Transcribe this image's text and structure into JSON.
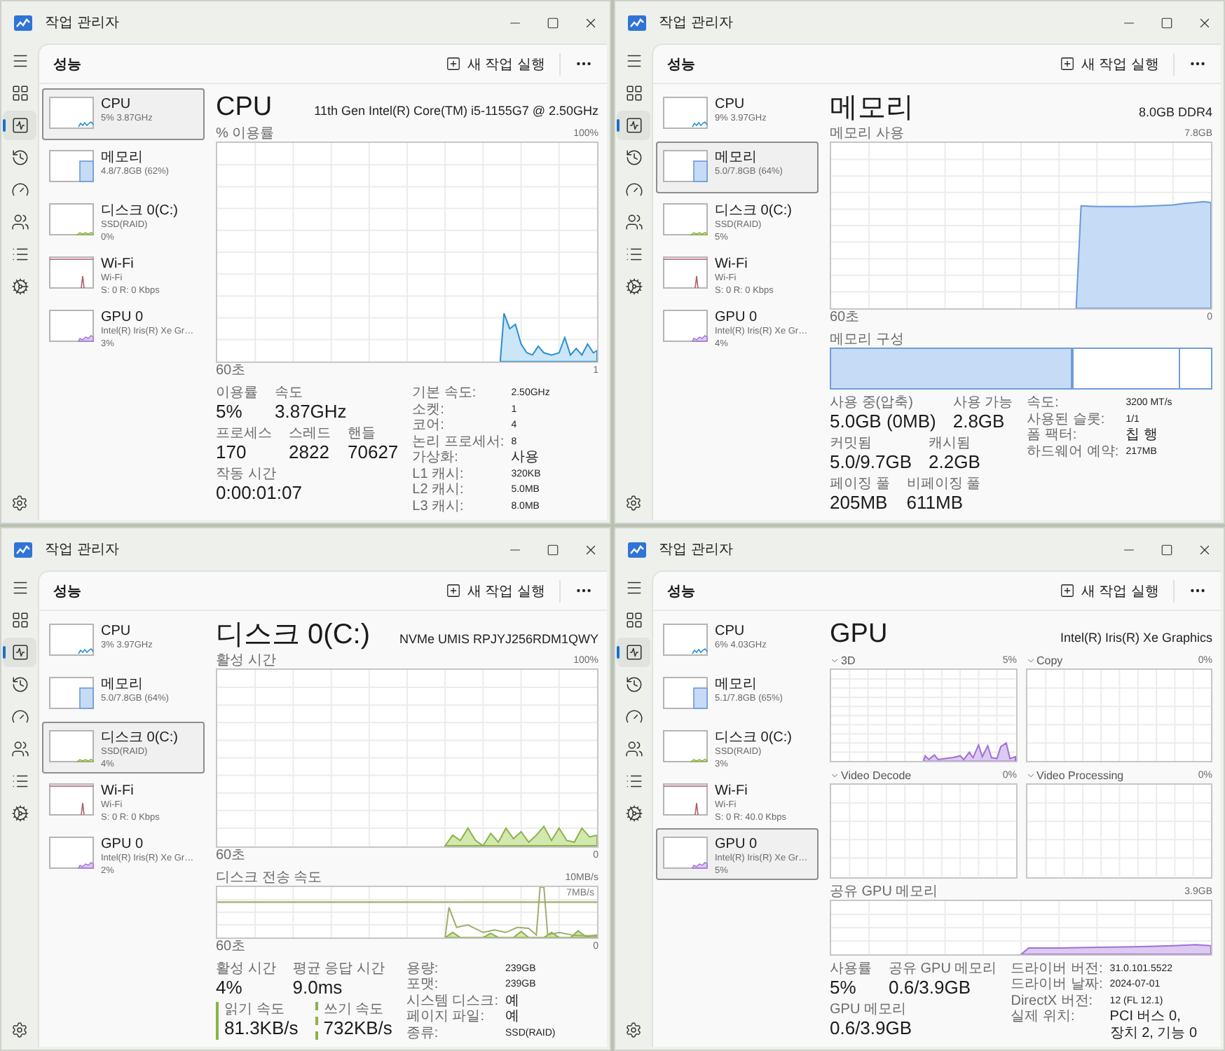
{
  "windows": [
    {
      "kind": "cpu",
      "title": "작업 관리자",
      "nav": [
        {
          "selected": false
        },
        {
          "selected": true
        },
        {
          "selected": false
        },
        {
          "selected": false
        },
        {
          "selected": false
        },
        {
          "selected": false
        },
        {
          "selected": false
        }
      ],
      "page_title": "성능",
      "run_task": "새 작업 실행",
      "devices": [
        {
          "kind": "cpu",
          "name": "CPU",
          "details": [
            "5% 3.87GHz"
          ],
          "selected": true
        },
        {
          "kind": "memory",
          "name": "메모리",
          "details": [
            "4.8/7.8GB (62%)"
          ],
          "selected": false
        },
        {
          "kind": "disk",
          "name": "디스크 0(C:)",
          "details": [
            "SSD(RAID)",
            "0%"
          ],
          "selected": false
        },
        {
          "kind": "network",
          "name": "Wi-Fi",
          "details": [
            "Wi-Fi",
            "S: 0 R: 0 Kbps"
          ],
          "selected": false
        },
        {
          "kind": "gpu",
          "name": "GPU 0",
          "details": [
            "Intel(R) Iris(R) Xe Gr…",
            "3%"
          ],
          "selected": false
        }
      ],
      "detail": {
        "title": "CPU",
        "model": "11th Gen Intel(R) Core(TM) i5-1155G7 @ 2.50GHz",
        "graphs": [
          {
            "label": "% 이용률",
            "max": "100%",
            "start": "60초",
            "end": "1"
          }
        ],
        "stats": [
          [
            {
              "label": "이용률",
              "value": "5%"
            },
            {
              "label": "속도",
              "value": "3.87GHz"
            }
          ],
          [
            {
              "label": "프로세스",
              "value": "170"
            },
            {
              "label": "스레드",
              "value": "2822"
            },
            {
              "label": "핸들",
              "value": "70627"
            }
          ],
          [
            {
              "label": "작동 시간",
              "value": "0:00:01:07"
            }
          ]
        ],
        "properties": [
          {
            "key": "기본 속도:",
            "value": "2.50GHz"
          },
          {
            "key": "소켓:",
            "value": "1"
          },
          {
            "key": "코어:",
            "value": "4"
          },
          {
            "key": "논리 프로세서:",
            "value": "8"
          },
          {
            "key": "가상화:",
            "value": "사용"
          },
          {
            "key": "L1 캐시:",
            "value": "320KB"
          },
          {
            "key": "L2 캐시:",
            "value": "5.0MB"
          },
          {
            "key": "L3 캐시:",
            "value": "8.0MB"
          }
        ]
      }
    },
    {
      "kind": "memory",
      "title": "작업 관리자",
      "nav": [
        {
          "selected": false
        },
        {
          "selected": true
        },
        {
          "selected": false
        },
        {
          "selected": false
        },
        {
          "selected": false
        },
        {
          "selected": false
        },
        {
          "selected": false
        }
      ],
      "page_title": "성능",
      "run_task": "새 작업 실행",
      "devices": [
        {
          "kind": "cpu",
          "name": "CPU",
          "details": [
            "9% 3.97GHz"
          ],
          "selected": false
        },
        {
          "kind": "memory",
          "name": "메모리",
          "details": [
            "5.0/7.8GB (64%)"
          ],
          "selected": true
        },
        {
          "kind": "disk",
          "name": "디스크 0(C:)",
          "details": [
            "SSD(RAID)",
            "5%"
          ],
          "selected": false
        },
        {
          "kind": "network",
          "name": "Wi-Fi",
          "details": [
            "Wi-Fi",
            "S: 0 R: 0 Kbps"
          ],
          "selected": false
        },
        {
          "kind": "gpu",
          "name": "GPU 0",
          "details": [
            "Intel(R) Iris(R) Xe Gr…",
            "4%"
          ],
          "selected": false
        }
      ],
      "detail": {
        "title": "메모리",
        "model": "8.0GB DDR4",
        "graphs": [
          {
            "label": "메모리 사용",
            "max": "7.8GB",
            "start": "60초",
            "end": "0"
          }
        ],
        "composition": {
          "label": "메모리 구성"
        },
        "stats": [
          [
            {
              "label": "사용 중(압축)",
              "value": "5.0GB (0MB)"
            },
            {
              "label": "사용 가능",
              "value": "2.8GB"
            }
          ],
          [
            {
              "label": "커밋됨",
              "value": "5.0/9.7GB"
            },
            {
              "label": "캐시됨",
              "value": "2.2GB"
            }
          ],
          [
            {
              "label": "페이징 풀",
              "value": "205MB"
            },
            {
              "label": "비페이징 풀",
              "value": "611MB"
            }
          ]
        ],
        "properties": [
          {
            "key": "속도:",
            "value": "3200 MT/s"
          },
          {
            "key": "사용된 슬롯:",
            "value": "1/1"
          },
          {
            "key": "폼 팩터:",
            "value": "칩 행"
          },
          {
            "key": "하드웨어 예약:",
            "value": "217MB"
          }
        ]
      }
    },
    {
      "kind": "disk",
      "title": "작업 관리자",
      "nav": [
        {
          "selected": false
        },
        {
          "selected": true
        },
        {
          "selected": false
        },
        {
          "selected": false
        },
        {
          "selected": false
        },
        {
          "selected": false
        },
        {
          "selected": false
        }
      ],
      "page_title": "성능",
      "run_task": "새 작업 실행",
      "devices": [
        {
          "kind": "cpu",
          "name": "CPU",
          "details": [
            "3% 3.97GHz"
          ],
          "selected": false
        },
        {
          "kind": "memory",
          "name": "메모리",
          "details": [
            "5.0/7.8GB (64%)"
          ],
          "selected": false
        },
        {
          "kind": "disk",
          "name": "디스크 0(C:)",
          "details": [
            "SSD(RAID)",
            "4%"
          ],
          "selected": true
        },
        {
          "kind": "network",
          "name": "Wi-Fi",
          "details": [
            "Wi-Fi",
            "S: 0 R: 0 Kbps"
          ],
          "selected": false
        },
        {
          "kind": "gpu",
          "name": "GPU 0",
          "details": [
            "Intel(R) Iris(R) Xe Gr…",
            "2%"
          ],
          "selected": false
        }
      ],
      "detail": {
        "title": "디스크 0(C:)",
        "model": "NVMe UMIS RPJYJ256RDM1QWY",
        "graphs": [
          {
            "label": "활성 시간",
            "max": "100%",
            "start": "60초",
            "end": "0"
          },
          {
            "label": "디스크 전송 속도",
            "max": "10MB/s",
            "marker": "7MB/s",
            "start": "60초",
            "end": "0"
          }
        ],
        "stats": [
          [
            {
              "kind": "plain",
              "label": "활성 시간",
              "value": "4%"
            },
            {
              "kind": "plain",
              "label": "평균 응답 시간",
              "value": "9.0ms"
            }
          ],
          [
            {
              "kind": "read",
              "label": "읽기 속도",
              "value": "81.3KB/s"
            },
            {
              "kind": "write",
              "label": "쓰기 속도",
              "value": "732KB/s"
            }
          ]
        ],
        "properties": [
          {
            "key": "용량:",
            "value": "239GB"
          },
          {
            "key": "포맷:",
            "value": "239GB"
          },
          {
            "key": "시스템 디스크:",
            "value": "예"
          },
          {
            "key": "페이지 파일:",
            "value": "예"
          },
          {
            "key": "종류:",
            "value": "SSD(RAID)"
          }
        ]
      }
    },
    {
      "kind": "gpu",
      "title": "작업 관리자",
      "nav": [
        {
          "selected": false
        },
        {
          "selected": true
        },
        {
          "selected": false
        },
        {
          "selected": false
        },
        {
          "selected": false
        },
        {
          "selected": false
        },
        {
          "selected": false
        }
      ],
      "page_title": "성능",
      "run_task": "새 작업 실행",
      "devices": [
        {
          "kind": "cpu",
          "name": "CPU",
          "details": [
            "6% 4.03GHz"
          ],
          "selected": false
        },
        {
          "kind": "memory",
          "name": "메모리",
          "details": [
            "5.1/7.8GB (65%)"
          ],
          "selected": false
        },
        {
          "kind": "disk",
          "name": "디스크 0(C:)",
          "details": [
            "SSD(RAID)",
            "3%"
          ],
          "selected": false
        },
        {
          "kind": "network",
          "name": "Wi-Fi",
          "details": [
            "Wi-Fi",
            "S: 0 R: 40.0 Kbps"
          ],
          "selected": false
        },
        {
          "kind": "gpu",
          "name": "GPU 0",
          "details": [
            "Intel(R) Iris(R) Xe Gr…",
            "5%"
          ],
          "selected": true
        }
      ],
      "detail": {
        "title": "GPU",
        "model": "Intel(R) Iris(R) Xe Graphics",
        "engines": [
          {
            "label": "3D",
            "value": "5%"
          },
          {
            "label": "Copy",
            "value": "0%"
          },
          {
            "label": "Video Decode",
            "value": "0%"
          },
          {
            "label": "Video Processing",
            "value": "0%"
          }
        ],
        "graphs": [
          {
            "label": "공유 GPU 메모리",
            "max": "3.9GB"
          }
        ],
        "stats": [
          [
            {
              "label": "사용률",
              "value": "5%"
            },
            {
              "label": "공유 GPU 메모리",
              "value": "0.6/3.9GB"
            }
          ],
          [
            {
              "label": "GPU 메모리",
              "value": "0.6/3.9GB"
            }
          ]
        ],
        "properties": [
          {
            "key": "드라이버 버전:",
            "value": "31.0.101.5522"
          },
          {
            "key": "드라이버 날짜:",
            "value": "2024-07-01"
          },
          {
            "key": "DirectX 버전:",
            "value": "12 (FL 12.1)"
          },
          {
            "key": "실제 위치:",
            "value": "PCI 버스 0, 장치 2, 기능 0"
          }
        ]
      }
    }
  ]
}
